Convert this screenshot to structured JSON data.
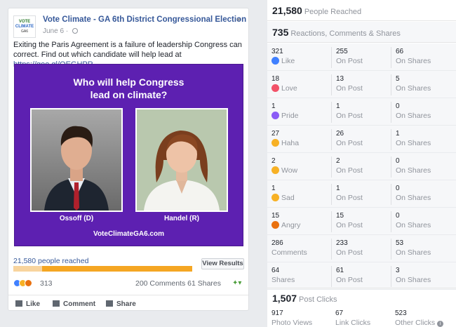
{
  "post": {
    "page_logo": {
      "line1": "VOTE",
      "line2": "CLIMATE",
      "line3": "GA6"
    },
    "page_name": "Vote Climate - GA 6th District Congressional Election",
    "date": "June 6",
    "text": "Exiting the Paris Agreement is a failure of leadership Congress can correct. Find out which candidate will help lead at ",
    "link": "https://goo.gl/OEGHPR",
    "link_suffix": ".",
    "image": {
      "title_line1": "Who will help Congress",
      "title_line2": "lead on climate?",
      "left_caption": "Ossoff (D)",
      "right_caption": "Handel (R)",
      "url": "VoteClimateGA6.com",
      "bg_color": "#5d20b1"
    },
    "reach_text": "21,580 people reached",
    "reach_bar_fraction": 0.16,
    "view_results": "View Results",
    "reactions_count": "313",
    "comments": "200 Comments",
    "shares": "61 Shares",
    "actions": {
      "like": "Like",
      "comment": "Comment",
      "share": "Share"
    }
  },
  "insights": {
    "people_reached": {
      "value": "21,580",
      "label": "People Reached"
    },
    "engagement": {
      "value": "735",
      "label": "Reactions, Comments & Shares"
    },
    "rows": [
      {
        "cells": [
          {
            "num": "321",
            "label": "Like",
            "icon": "like",
            "color": "#4080ff"
          },
          {
            "num": "255",
            "label": "On Post"
          },
          {
            "num": "66",
            "label": "On Shares"
          }
        ]
      },
      {
        "cells": [
          {
            "num": "18",
            "label": "Love",
            "icon": "love",
            "color": "#f25268"
          },
          {
            "num": "13",
            "label": "On Post"
          },
          {
            "num": "5",
            "label": "On Shares"
          }
        ]
      },
      {
        "cells": [
          {
            "num": "1",
            "label": "Pride",
            "icon": "pride",
            "color": "#8b5cf6"
          },
          {
            "num": "1",
            "label": "On Post"
          },
          {
            "num": "0",
            "label": "On Shares"
          }
        ]
      },
      {
        "cells": [
          {
            "num": "27",
            "label": "Haha",
            "icon": "haha",
            "color": "#f7b125"
          },
          {
            "num": "26",
            "label": "On Post"
          },
          {
            "num": "1",
            "label": "On Shares"
          }
        ]
      },
      {
        "cells": [
          {
            "num": "2",
            "label": "Wow",
            "icon": "wow",
            "color": "#f7b125"
          },
          {
            "num": "2",
            "label": "On Post"
          },
          {
            "num": "0",
            "label": "On Shares"
          }
        ]
      },
      {
        "cells": [
          {
            "num": "1",
            "label": "Sad",
            "icon": "sad",
            "color": "#f7b125"
          },
          {
            "num": "1",
            "label": "On Post"
          },
          {
            "num": "0",
            "label": "On Shares"
          }
        ]
      },
      {
        "cells": [
          {
            "num": "15",
            "label": "Angry",
            "icon": "angry",
            "color": "#e9710f"
          },
          {
            "num": "15",
            "label": "On Post"
          },
          {
            "num": "0",
            "label": "On Shares"
          }
        ]
      },
      {
        "cells": [
          {
            "num": "286",
            "label": "Comments"
          },
          {
            "num": "233",
            "label": "On Post"
          },
          {
            "num": "53",
            "label": "On Shares"
          }
        ]
      },
      {
        "cells": [
          {
            "num": "64",
            "label": "Shares"
          },
          {
            "num": "61",
            "label": "On Post"
          },
          {
            "num": "3",
            "label": "On Shares"
          }
        ]
      }
    ],
    "post_clicks": {
      "value": "1,507",
      "label": "Post Clicks"
    },
    "clicks": [
      {
        "num": "917",
        "label": "Photo Views"
      },
      {
        "num": "67",
        "label": "Link Clicks"
      },
      {
        "num": "523",
        "label": "Other Clicks"
      }
    ]
  }
}
